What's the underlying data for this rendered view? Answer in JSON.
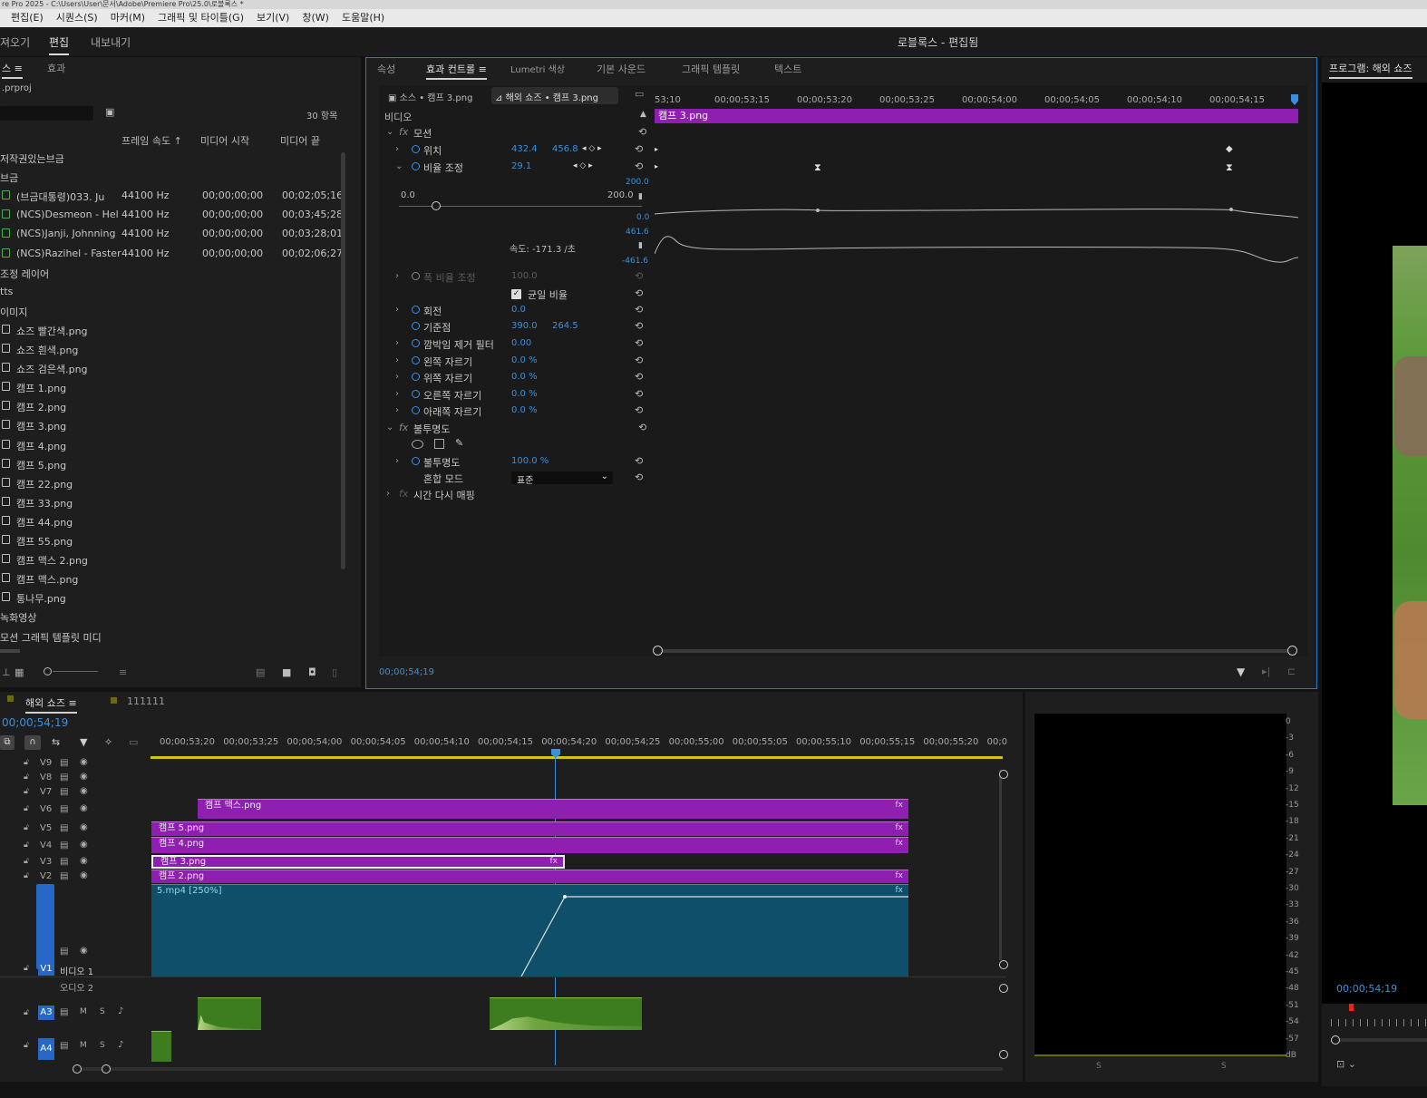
{
  "app": {
    "title_bar": "re Pro 2025 - C:\\Users\\User\\문서\\Adobe\\Premiere Pro\\25.0\\로블록스 *",
    "menu": [
      "편집(E)",
      "시퀀스(S)",
      "마커(M)",
      "그래픽 및 타이틀(G)",
      "보기(V)",
      "창(W)",
      "도움말(H)"
    ]
  },
  "workspace": {
    "tabs": [
      "져오기",
      "편집",
      "내보내기"
    ],
    "active_tab": "편집",
    "title": "로블록스 - 편집됨"
  },
  "project": {
    "tabs": [
      "스 ≡",
      "효과"
    ],
    "file": ".prproj",
    "item_count": "30 항목",
    "columns": [
      "프레임 속도 ↑",
      "미디어 시작",
      "미디어 끝"
    ],
    "rows": [
      {
        "type": "folder",
        "name": "저작권있는브금"
      },
      {
        "type": "folder",
        "name": "브금"
      },
      {
        "type": "audio",
        "name": "(브금대통령)033. Ju",
        "rate": "44100 Hz",
        "start": "00;00;00;00",
        "end": "00;02;05;16"
      },
      {
        "type": "audio",
        "name": "(NCS)Desmeon - Hel",
        "rate": "44100 Hz",
        "start": "00;00;00;00",
        "end": "00;03;45;28"
      },
      {
        "type": "audio",
        "name": "(NCS)Janji, Johnning",
        "rate": "44100 Hz",
        "start": "00;00;00;00",
        "end": "00;03;28;01"
      },
      {
        "type": "audio",
        "name": "(NCS)Razihel - Faster",
        "rate": "44100 Hz",
        "start": "00;00;00;00",
        "end": "00;02;06;27"
      },
      {
        "type": "folder",
        "name": "조정 레이어"
      },
      {
        "type": "folder",
        "name": "tts"
      },
      {
        "type": "folder",
        "name": "이미지"
      },
      {
        "type": "image",
        "name": "쇼즈 빨간색.png"
      },
      {
        "type": "image",
        "name": "쇼즈 흰색.png"
      },
      {
        "type": "image",
        "name": "쇼즈 검은색.png"
      },
      {
        "type": "image",
        "name": "캠프 1.png"
      },
      {
        "type": "image",
        "name": "캠프 2.png"
      },
      {
        "type": "image",
        "name": "캠프 3.png"
      },
      {
        "type": "image",
        "name": "캠프 4.png"
      },
      {
        "type": "image",
        "name": "캠프 5.png"
      },
      {
        "type": "image",
        "name": "캠프 22.png"
      },
      {
        "type": "image",
        "name": "캠프 33.png"
      },
      {
        "type": "image",
        "name": "캠프 44.png"
      },
      {
        "type": "image",
        "name": "캠프 55.png"
      },
      {
        "type": "image",
        "name": "캠프 맥스 2.png"
      },
      {
        "type": "image",
        "name": "캠프 맥스.png"
      },
      {
        "type": "image",
        "name": "통나무.png"
      },
      {
        "type": "folder",
        "name": "녹화영상"
      },
      {
        "type": "folder",
        "name": "모션 그래픽 템플릿 미디"
      }
    ]
  },
  "effects": {
    "tabs": [
      "속성",
      "효과 컨트롤 ≡",
      "Lumetri 색상",
      "기본 사운드",
      "그래픽 템플릿",
      "텍스트"
    ],
    "active_tab": "효과 컨트롤 ≡",
    "source_chip": "소스 • 캠프 3.png",
    "sequence_chip": "해외 쇼즈 • 캠프 3.png",
    "ruler": [
      "53;10",
      "00;00;53;15",
      "00;00;53;20",
      "00;00;53;25",
      "00;00;54;00",
      "00;00;54;05",
      "00;00;54;10",
      "00;00;54;15"
    ],
    "clip_label": "캠프 3.png",
    "section_video": "비디오",
    "motion": "모션",
    "position_label": "위치",
    "position_x": "432.4",
    "position_y": "456.8",
    "scale_label": "비율 조정",
    "scale_value": "29.1",
    "graph_top": "200.0",
    "graph_zero": "0.0",
    "graph_left": "0.0",
    "graph_right": "200.0",
    "vel_top": "461.6",
    "vel_bottom": "-461.6",
    "speed": "속도: -171.3 /초",
    "width_scale_label": "폭 비율 조정",
    "width_scale_value": "100.0",
    "uniform_label": "균일 비율",
    "rotation_label": "회전",
    "rotation_value": "0.0",
    "anchor_label": "기준점",
    "anchor_x": "390.0",
    "anchor_y": "264.5",
    "flicker_label": "깜박임 제거 필터",
    "flicker_value": "0.00",
    "crop_left_label": "왼쪽 자르기",
    "crop_top_label": "위쪽 자르기",
    "crop_right_label": "오른쪽 자르기",
    "crop_bottom_label": "아래쪽 자르기",
    "crop_value": "0.0 %",
    "opacity_section": "불투명도",
    "opacity_label": "불투명도",
    "opacity_value": "100.0 %",
    "blend_label": "혼합 모드",
    "blend_value": "표준",
    "time_remap": "시간 다시 매핑",
    "timecode": "00;00;54;19"
  },
  "program": {
    "title": "프로그램: 해외 쇼즈",
    "timecode": "00;00;54;19"
  },
  "timeline": {
    "tab": "해외 쇼즈 ≡",
    "tab2": "111111",
    "timecode": "00;00;54;19",
    "ruler": [
      "00;00;53;20",
      "00;00;53;25",
      "00;00;54;00",
      "00;00;54;05",
      "00;00;54;10",
      "00;00;54;15",
      "00;00;54;20",
      "00;00;54;25",
      "00;00;55;00",
      "00;00;55;05",
      "00;00;55;10",
      "00;00;55;15",
      "00;00;55;20",
      "00;0"
    ],
    "tracks": [
      "V9",
      "V8",
      "V7",
      "V6",
      "V5",
      "V4",
      "V3",
      "V2",
      "V1"
    ],
    "v1_name": "비디오 1",
    "a2_name": "오디오 2",
    "audio_tracks": [
      "A3",
      "A4"
    ],
    "clips": {
      "v6": "캠프 맥스.png",
      "v5": "캠프 5.png",
      "v4": "캠프 4.png",
      "v3": "캠프 3.png",
      "v2": "캠프 2.png",
      "v1": "5.mp4 [250%]"
    },
    "fx": "fx"
  },
  "meter": {
    "scale": [
      "0",
      "-3",
      "-6",
      "-9",
      "-12",
      "-15",
      "-18",
      "-21",
      "-24",
      "-27",
      "-30",
      "-33",
      "-36",
      "-39",
      "-42",
      "-45",
      "-48",
      "-51",
      "-54",
      "-57",
      "dB"
    ],
    "footer": [
      "S",
      "S"
    ]
  }
}
